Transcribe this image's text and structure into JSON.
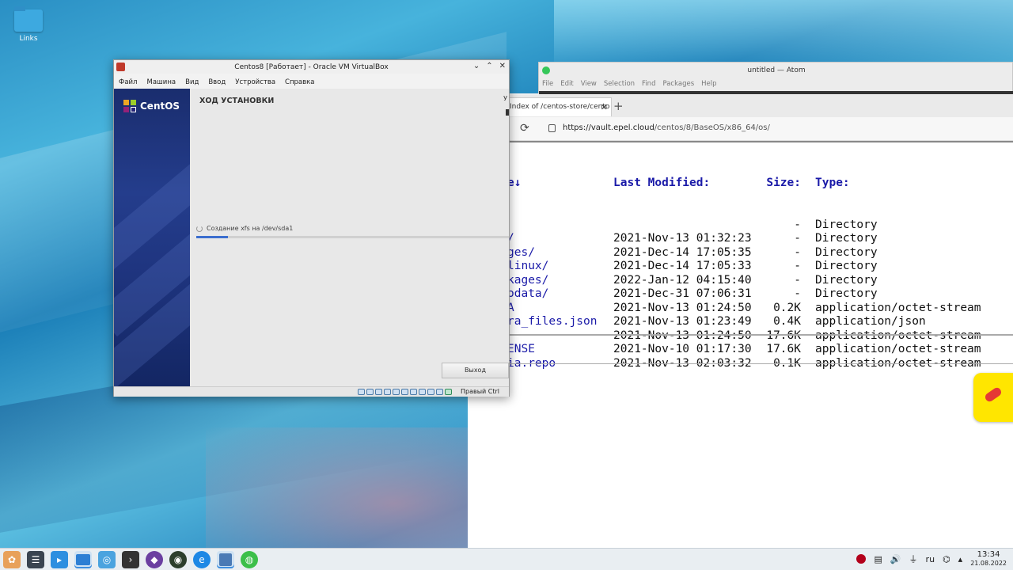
{
  "desktop": {
    "icons": [
      {
        "label": "Links",
        "icon": "folder-icon"
      }
    ]
  },
  "atom": {
    "title": "untitled — Atom",
    "menu": [
      "File",
      "Edit",
      "View",
      "Selection",
      "Find",
      "Packages",
      "Help"
    ]
  },
  "browser": {
    "tab_title": "Index of /centos-store/cento",
    "url_host": "https://vault.epel.cloud",
    "url_path": "/centos/8/BaseOS/x86_64/os/",
    "listing": {
      "headers": {
        "name": "e↓",
        "modified": "Last Modified:",
        "size": "Size:",
        "type": "Type:"
      },
      "rows": [
        {
          "name": "",
          "modified": "",
          "size": "-",
          "type": "Directory"
        },
        {
          "name": "/",
          "modified": "2021-Nov-13 01:32:23",
          "size": "-",
          "type": "Directory"
        },
        {
          "name": "ges/",
          "modified": "2021-Dec-14 17:05:35",
          "size": "-",
          "type": "Directory"
        },
        {
          "name": "linux/",
          "modified": "2021-Dec-14 17:05:33",
          "size": "-",
          "type": "Directory"
        },
        {
          "name": "kages/",
          "modified": "2022-Jan-12 04:15:40",
          "size": "-",
          "type": "Directory"
        },
        {
          "name": "odata/",
          "modified": "2021-Dec-31 07:06:31",
          "size": "-",
          "type": "Directory"
        },
        {
          "name": "A",
          "modified": "2021-Nov-13 01:24:50",
          "size": "0.2K",
          "type": "application/octet-stream"
        },
        {
          "name": "ra_files.json",
          "modified": "2021-Nov-13 01:23:49",
          "size": "0.4K",
          "type": "application/json"
        },
        {
          "name": "",
          "modified": "2021-Nov-13 01:24:50",
          "size": "17.6K",
          "type": "application/octet-stream"
        },
        {
          "name": "ENSE",
          "modified": "2021-Nov-10 01:17:30",
          "size": "17.6K",
          "type": "application/octet-stream"
        },
        {
          "name": "ia.repo",
          "modified": "2021-Nov-13 02:03:32",
          "size": "0.1K",
          "type": "application/octet-stream"
        }
      ]
    }
  },
  "vbox": {
    "title": "Centos8 [Работает] - Oracle VM VirtualBox",
    "menu": [
      "Файл",
      "Машина",
      "Вид",
      "Ввод",
      "Устройства",
      "Справка"
    ],
    "logo_text": "CentOS",
    "install_title": "ХОД УСТАНОВКИ",
    "edge_char": "У",
    "progress_text": "Создание xfs на /dev/sda1",
    "progress_fraction": 0.1,
    "exit_label": "Выход",
    "host_key": "Правый Ctrl"
  },
  "taskbar": {
    "lang": "ru",
    "time": "13:34",
    "date": "21.08.2022"
  }
}
